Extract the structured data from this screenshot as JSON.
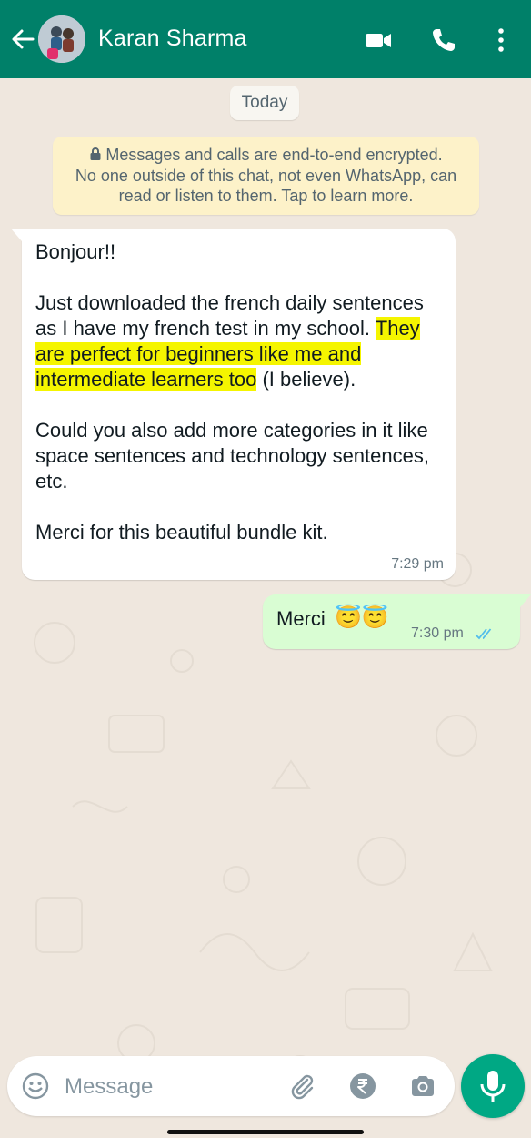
{
  "header": {
    "contact_name": "Karan Sharma",
    "bg_color": "#008069"
  },
  "chat": {
    "date_chip": "Today",
    "encryption_notice": {
      "line1": "Messages and calls are end-to-end encrypted.",
      "line2": "No one outside of this chat, not even WhatsApp, can",
      "line3": "read or listen to them. Tap to learn more."
    },
    "incoming": {
      "greeting": "Bonjour!!",
      "p2_before": "Just downloaded the french daily sentences as I have my french test in my school. ",
      "p2_highlight": "They are perfect for beginners like me and intermediate learners too",
      "p2_after": " (I believe).",
      "p3": "Could you also add more categories in it like space sentences and technology sentences, etc.",
      "p4": "Merci for this beautiful bundle kit.",
      "time": "7:29 pm"
    },
    "outgoing": {
      "text": "Merci",
      "emoji": "😇😇",
      "time": "7:30 pm"
    }
  },
  "composer": {
    "placeholder": "Message",
    "icons": [
      "emoji-icon",
      "attach-icon",
      "rupee-payment-icon",
      "camera-icon",
      "mic-icon"
    ]
  },
  "colors": {
    "wallpaper": "#efe7de",
    "incoming_bubble": "#ffffff",
    "outgoing_bubble": "#d9fdd3",
    "highlight": "#f5f500",
    "accent_green": "#00a884",
    "read_ticks": "#53bdeb"
  }
}
